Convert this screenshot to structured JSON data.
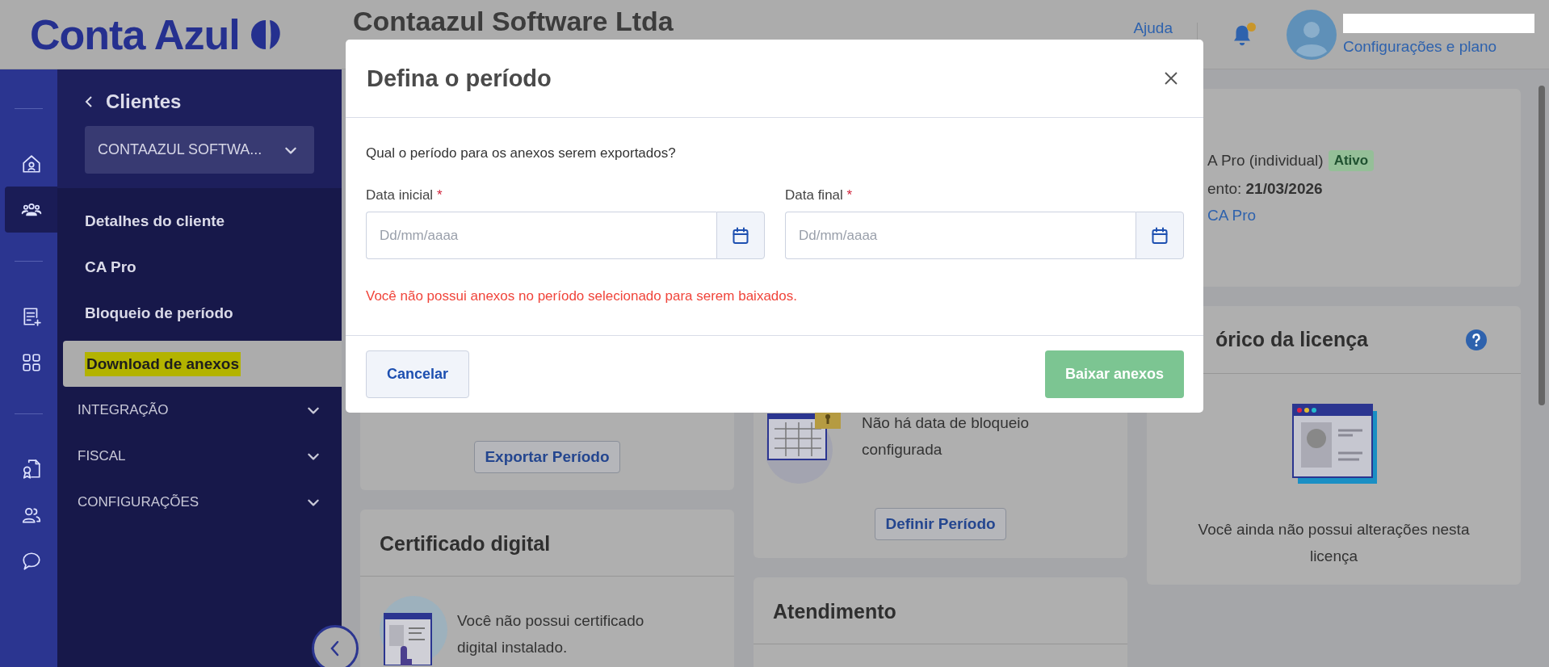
{
  "topbar": {
    "logo": "Conta Azul",
    "company": "Contaazul Software Ltda",
    "help_link": "Ajuda",
    "has_notifications": true,
    "user_link": "Configurações e plano"
  },
  "rail": {
    "groups": [
      {
        "items": [
          {
            "kind": "home",
            "selected": false
          },
          {
            "kind": "team",
            "selected": true
          }
        ]
      },
      {
        "items": [
          {
            "kind": "report",
            "selected": false
          },
          {
            "kind": "apps",
            "selected": false
          }
        ]
      },
      {
        "items": [
          {
            "kind": "document",
            "selected": false
          },
          {
            "kind": "users",
            "selected": false
          },
          {
            "kind": "chat",
            "selected": false
          }
        ]
      }
    ]
  },
  "sidebar": {
    "back_title": "Clientes",
    "client_select": "CONTAAZUL SOFTWA...",
    "items": [
      {
        "label": "Detalhes do cliente",
        "selected": false,
        "highlighted": false
      },
      {
        "label": "CA Pro",
        "selected": false,
        "highlighted": false
      },
      {
        "label": "Bloqueio de período",
        "selected": false,
        "highlighted": false
      },
      {
        "label": "Download de anexos",
        "selected": true,
        "highlighted": true
      }
    ],
    "sections": [
      {
        "label": "INTEGRAÇÃO",
        "expanded": false
      },
      {
        "label": "FISCAL",
        "expanded": false
      },
      {
        "label": "CONFIGURAÇÕES",
        "expanded": false
      }
    ]
  },
  "export_card": {
    "button": "Exportar Período"
  },
  "certificate_card": {
    "title": "Certificado digital",
    "message": "Você não possui certificado digital instalado."
  },
  "lock_card": {
    "message": "Não há data de bloqueio configurada",
    "button": "Definir Período"
  },
  "support_card": {
    "title": "Atendimento"
  },
  "plan_card": {
    "plan": "A Pro (individual)",
    "status": "Ativo",
    "due": "ento: **21/03/2026**",
    "link": "CA Pro"
  },
  "license_card": {
    "title": "órico da licença",
    "message": "Você ainda não possui alterações nesta licença"
  },
  "modal": {
    "title": "Defina o período",
    "question": "Qual o período para os anexos serem exportados?",
    "fields": [
      {
        "label": "Data inicial",
        "required_mark": "*",
        "placeholder": "Dd/mm/aaaa"
      },
      {
        "label": "Data final",
        "required_mark": "*",
        "placeholder": "Dd/mm/aaaa"
      }
    ],
    "error": "Você não possui anexos no período selecionado para serem baixados.",
    "buttons": [
      {
        "label": "Cancelar",
        "kind": "secondary",
        "disabled": false
      },
      {
        "label": "Baixar anexos",
        "kind": "primary",
        "disabled": true
      }
    ]
  }
}
